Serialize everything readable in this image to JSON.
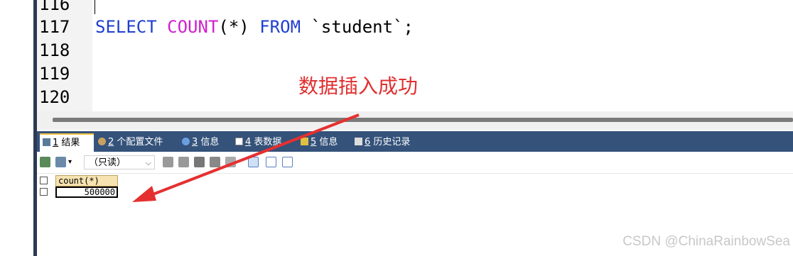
{
  "editor": {
    "lines": [
      {
        "number": "116",
        "code": ""
      },
      {
        "number": "117",
        "code": "SELECT COUNT(*) FROM `student`;"
      },
      {
        "number": "118",
        "code": ""
      },
      {
        "number": "119",
        "code": ""
      },
      {
        "number": "120",
        "code": ""
      }
    ],
    "sql": {
      "select": "SELECT",
      "count": "COUNT",
      "paren": "(*)",
      "from": "FROM",
      "table": "`student`",
      "semicolon": ";"
    }
  },
  "annotation": "数据插入成功",
  "tabs": [
    {
      "num": "1",
      "label": " 结果",
      "icon": "grid-result-icon",
      "active": true
    },
    {
      "num": "2",
      "label": " 个配置文件",
      "icon": "profile-icon",
      "active": false
    },
    {
      "num": "3",
      "label": " 信息",
      "icon": "info-icon",
      "active": false
    },
    {
      "num": "4",
      "label": " 表数据",
      "icon": "table-icon",
      "active": false
    },
    {
      "num": "5",
      "label": " 信息",
      "icon": "info-icon",
      "active": false
    },
    {
      "num": "6",
      "label": " 历史记录",
      "icon": "history-icon",
      "active": false
    }
  ],
  "toolbar": {
    "readonly_label": "（只读）"
  },
  "result_grid": {
    "columns": [
      "count(*)"
    ],
    "rows": [
      [
        "500000"
      ]
    ]
  },
  "watermark": "CSDN @ChinaRainbowSea",
  "colors": {
    "keyword": "#1f3fcf",
    "function": "#cf1fcf",
    "tabbar": "#34527a",
    "annotation": "#e03030"
  }
}
